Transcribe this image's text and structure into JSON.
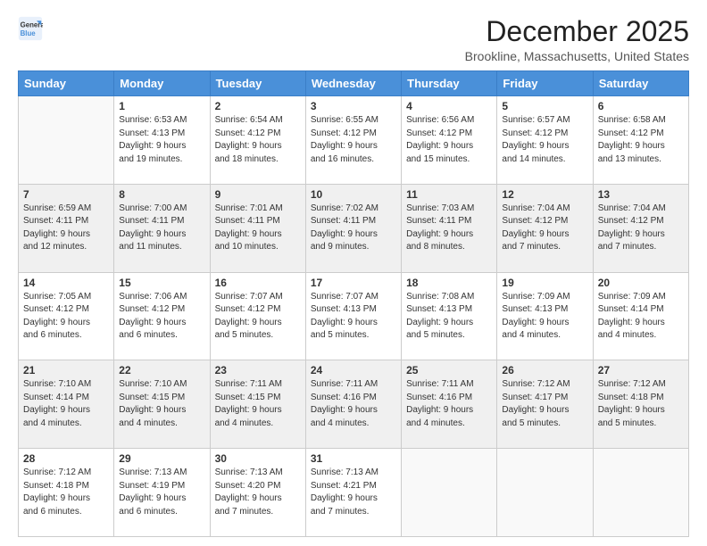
{
  "logo": {
    "line1": "General",
    "line2": "Blue"
  },
  "title": "December 2025",
  "location": "Brookline, Massachusetts, United States",
  "weekdays": [
    "Sunday",
    "Monday",
    "Tuesday",
    "Wednesday",
    "Thursday",
    "Friday",
    "Saturday"
  ],
  "weeks": [
    [
      {
        "day": "",
        "info": ""
      },
      {
        "day": "1",
        "info": "Sunrise: 6:53 AM\nSunset: 4:13 PM\nDaylight: 9 hours\nand 19 minutes."
      },
      {
        "day": "2",
        "info": "Sunrise: 6:54 AM\nSunset: 4:12 PM\nDaylight: 9 hours\nand 18 minutes."
      },
      {
        "day": "3",
        "info": "Sunrise: 6:55 AM\nSunset: 4:12 PM\nDaylight: 9 hours\nand 16 minutes."
      },
      {
        "day": "4",
        "info": "Sunrise: 6:56 AM\nSunset: 4:12 PM\nDaylight: 9 hours\nand 15 minutes."
      },
      {
        "day": "5",
        "info": "Sunrise: 6:57 AM\nSunset: 4:12 PM\nDaylight: 9 hours\nand 14 minutes."
      },
      {
        "day": "6",
        "info": "Sunrise: 6:58 AM\nSunset: 4:12 PM\nDaylight: 9 hours\nand 13 minutes."
      }
    ],
    [
      {
        "day": "7",
        "info": "Sunrise: 6:59 AM\nSunset: 4:11 PM\nDaylight: 9 hours\nand 12 minutes."
      },
      {
        "day": "8",
        "info": "Sunrise: 7:00 AM\nSunset: 4:11 PM\nDaylight: 9 hours\nand 11 minutes."
      },
      {
        "day": "9",
        "info": "Sunrise: 7:01 AM\nSunset: 4:11 PM\nDaylight: 9 hours\nand 10 minutes."
      },
      {
        "day": "10",
        "info": "Sunrise: 7:02 AM\nSunset: 4:11 PM\nDaylight: 9 hours\nand 9 minutes."
      },
      {
        "day": "11",
        "info": "Sunrise: 7:03 AM\nSunset: 4:11 PM\nDaylight: 9 hours\nand 8 minutes."
      },
      {
        "day": "12",
        "info": "Sunrise: 7:04 AM\nSunset: 4:12 PM\nDaylight: 9 hours\nand 7 minutes."
      },
      {
        "day": "13",
        "info": "Sunrise: 7:04 AM\nSunset: 4:12 PM\nDaylight: 9 hours\nand 7 minutes."
      }
    ],
    [
      {
        "day": "14",
        "info": "Sunrise: 7:05 AM\nSunset: 4:12 PM\nDaylight: 9 hours\nand 6 minutes."
      },
      {
        "day": "15",
        "info": "Sunrise: 7:06 AM\nSunset: 4:12 PM\nDaylight: 9 hours\nand 6 minutes."
      },
      {
        "day": "16",
        "info": "Sunrise: 7:07 AM\nSunset: 4:12 PM\nDaylight: 9 hours\nand 5 minutes."
      },
      {
        "day": "17",
        "info": "Sunrise: 7:07 AM\nSunset: 4:13 PM\nDaylight: 9 hours\nand 5 minutes."
      },
      {
        "day": "18",
        "info": "Sunrise: 7:08 AM\nSunset: 4:13 PM\nDaylight: 9 hours\nand 5 minutes."
      },
      {
        "day": "19",
        "info": "Sunrise: 7:09 AM\nSunset: 4:13 PM\nDaylight: 9 hours\nand 4 minutes."
      },
      {
        "day": "20",
        "info": "Sunrise: 7:09 AM\nSunset: 4:14 PM\nDaylight: 9 hours\nand 4 minutes."
      }
    ],
    [
      {
        "day": "21",
        "info": "Sunrise: 7:10 AM\nSunset: 4:14 PM\nDaylight: 9 hours\nand 4 minutes."
      },
      {
        "day": "22",
        "info": "Sunrise: 7:10 AM\nSunset: 4:15 PM\nDaylight: 9 hours\nand 4 minutes."
      },
      {
        "day": "23",
        "info": "Sunrise: 7:11 AM\nSunset: 4:15 PM\nDaylight: 9 hours\nand 4 minutes."
      },
      {
        "day": "24",
        "info": "Sunrise: 7:11 AM\nSunset: 4:16 PM\nDaylight: 9 hours\nand 4 minutes."
      },
      {
        "day": "25",
        "info": "Sunrise: 7:11 AM\nSunset: 4:16 PM\nDaylight: 9 hours\nand 4 minutes."
      },
      {
        "day": "26",
        "info": "Sunrise: 7:12 AM\nSunset: 4:17 PM\nDaylight: 9 hours\nand 5 minutes."
      },
      {
        "day": "27",
        "info": "Sunrise: 7:12 AM\nSunset: 4:18 PM\nDaylight: 9 hours\nand 5 minutes."
      }
    ],
    [
      {
        "day": "28",
        "info": "Sunrise: 7:12 AM\nSunset: 4:18 PM\nDaylight: 9 hours\nand 6 minutes."
      },
      {
        "day": "29",
        "info": "Sunrise: 7:13 AM\nSunset: 4:19 PM\nDaylight: 9 hours\nand 6 minutes."
      },
      {
        "day": "30",
        "info": "Sunrise: 7:13 AM\nSunset: 4:20 PM\nDaylight: 9 hours\nand 7 minutes."
      },
      {
        "day": "31",
        "info": "Sunrise: 7:13 AM\nSunset: 4:21 PM\nDaylight: 9 hours\nand 7 minutes."
      },
      {
        "day": "",
        "info": ""
      },
      {
        "day": "",
        "info": ""
      },
      {
        "day": "",
        "info": ""
      }
    ]
  ]
}
